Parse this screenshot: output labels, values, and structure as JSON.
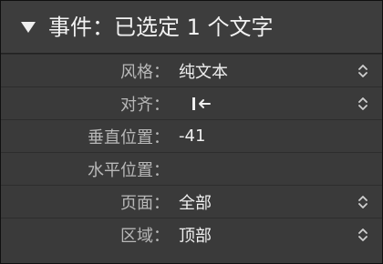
{
  "header": {
    "title": "事件：已选定 1 个文字"
  },
  "properties": [
    {
      "label": "风格：",
      "value": "纯文本",
      "has_stepper": true
    },
    {
      "label": "对齐：",
      "value": "",
      "icon": "align-left-icon",
      "has_stepper": true
    },
    {
      "label": "垂直位置：",
      "value": "-41",
      "has_stepper": false
    },
    {
      "label": "水平位置：",
      "value": "",
      "has_stepper": false
    },
    {
      "label": "页面：",
      "value": "全部",
      "has_stepper": true
    },
    {
      "label": "区域：",
      "value": "顶部",
      "has_stepper": true
    }
  ],
  "colors": {
    "panel_bg": "#3a3a3a",
    "label_text": "#b8b8b8",
    "value_text": "#efefef"
  }
}
